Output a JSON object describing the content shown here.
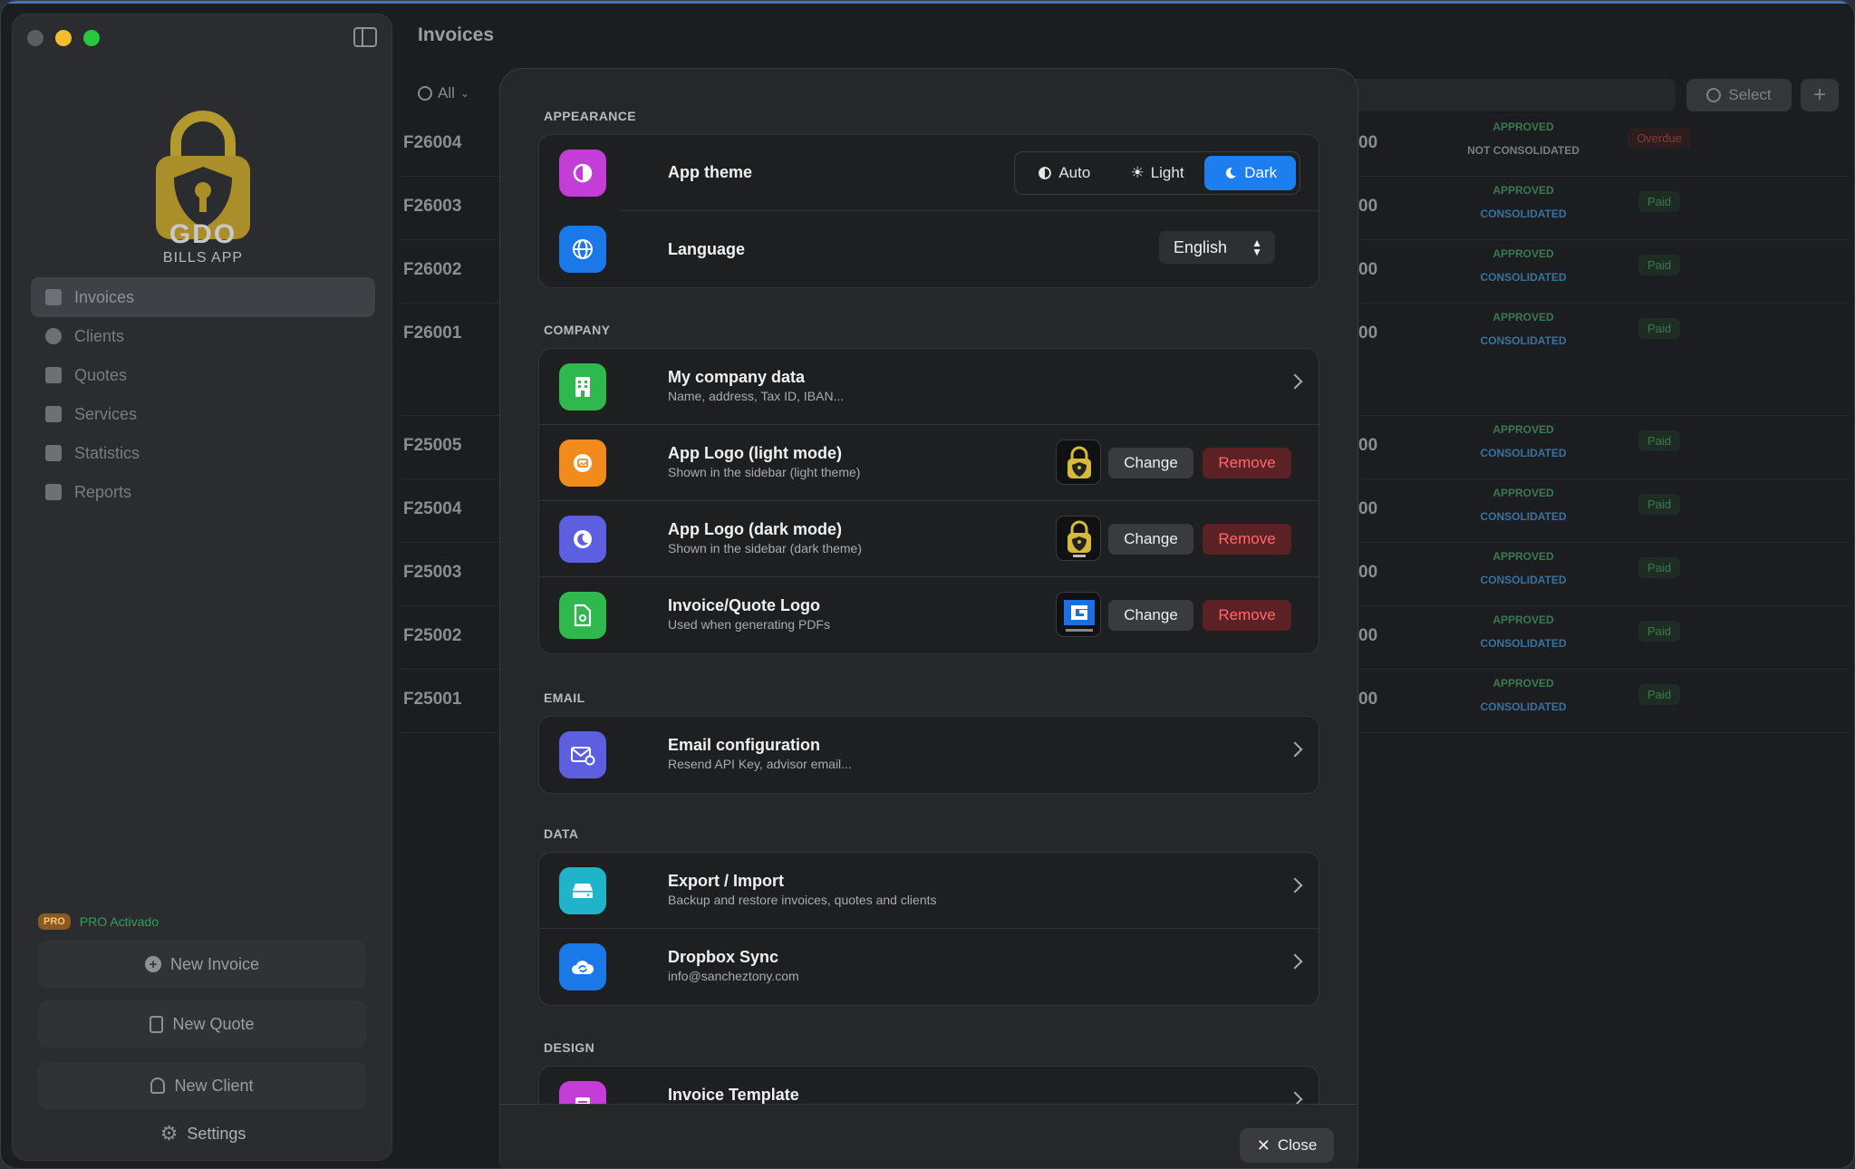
{
  "app": {
    "title": "Invoices",
    "brand_line1": "GDO",
    "brand_line2": "BILLS APP"
  },
  "sidebar": {
    "items": [
      {
        "label": "Invoices",
        "icon": "document-icon",
        "active": true
      },
      {
        "label": "Clients",
        "icon": "people-icon"
      },
      {
        "label": "Quotes",
        "icon": "document-icon"
      },
      {
        "label": "Services",
        "icon": "box-icon"
      },
      {
        "label": "Statistics",
        "icon": "bar-chart-icon"
      },
      {
        "label": "Reports",
        "icon": "report-icon"
      }
    ],
    "pro_badge": "PRO",
    "pro_status": "PRO Activado",
    "new_invoice": "New Invoice",
    "new_quote": "New Quote",
    "new_client": "New Client",
    "settings": "Settings"
  },
  "toolbar": {
    "filter": "All",
    "select": "Select",
    "add": "+"
  },
  "invoices": [
    {
      "number": "F26004",
      "amount": "00",
      "approval": "APPROVED",
      "consolidation": "NOT CONSOLIDATED",
      "status": "Overdue"
    },
    {
      "number": "F26003",
      "amount": "00",
      "approval": "APPROVED",
      "consolidation": "CONSOLIDATED",
      "status": "Paid"
    },
    {
      "number": "F26002",
      "amount": "00",
      "approval": "APPROVED",
      "consolidation": "CONSOLIDATED",
      "status": "Paid"
    },
    {
      "number": "F26001",
      "amount": "00",
      "approval": "APPROVED",
      "consolidation": "CONSOLIDATED",
      "status": "Paid"
    },
    {
      "number": "F25005",
      "amount": "00",
      "approval": "APPROVED",
      "consolidation": "CONSOLIDATED",
      "status": "Paid"
    },
    {
      "number": "F25004",
      "amount": "00",
      "approval": "APPROVED",
      "consolidation": "CONSOLIDATED",
      "status": "Paid"
    },
    {
      "number": "F25003",
      "amount": "00",
      "approval": "APPROVED",
      "consolidation": "CONSOLIDATED",
      "status": "Paid"
    },
    {
      "number": "F25002",
      "amount": "00",
      "approval": "APPROVED",
      "consolidation": "CONSOLIDATED",
      "status": "Paid"
    },
    {
      "number": "F25001",
      "amount": "00",
      "approval": "APPROVED",
      "consolidation": "CONSOLIDATED",
      "status": "Paid"
    }
  ],
  "settings": {
    "appearance": {
      "header": "APPEARANCE",
      "theme_label": "App theme",
      "theme_options": [
        "Auto",
        "Light",
        "Dark"
      ],
      "theme_selected": "Dark",
      "language_label": "Language",
      "language_value": "English"
    },
    "company": {
      "header": "COMPANY",
      "data_title": "My company data",
      "data_sub": "Name, address, Tax ID, IBAN...",
      "logo_light_title": "App Logo (light mode)",
      "logo_light_sub": "Shown in the sidebar (light theme)",
      "logo_dark_title": "App Logo (dark mode)",
      "logo_dark_sub": "Shown in the sidebar (dark theme)",
      "logo_invoice_title": "Invoice/Quote Logo",
      "logo_invoice_sub": "Used when generating PDFs",
      "change": "Change",
      "remove": "Remove"
    },
    "email": {
      "header": "EMAIL",
      "config_title": "Email configuration",
      "config_sub": "Resend API Key, advisor email..."
    },
    "data": {
      "header": "DATA",
      "export_title": "Export / Import",
      "export_sub": "Backup and restore invoices, quotes and clients",
      "dropbox_title": "Dropbox Sync",
      "dropbox_sub": "info@sancheztony.com"
    },
    "design": {
      "header": "DESIGN",
      "template_title": "Invoice Template"
    },
    "close": "Close"
  },
  "colors": {
    "accent": "#1d7ef0",
    "remove": "#ff6a6a",
    "pro": "#29a35a"
  }
}
